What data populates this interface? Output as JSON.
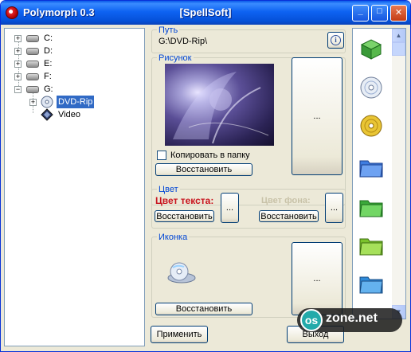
{
  "window": {
    "app_title": "Polymorph 0.3",
    "author": "[SpellSoft]",
    "minimize": "_",
    "maximize": "□",
    "close": "✕"
  },
  "tree": {
    "drives": [
      {
        "label": "C:",
        "expander": "+"
      },
      {
        "label": "D:",
        "expander": "+"
      },
      {
        "label": "E:",
        "expander": "+"
      },
      {
        "label": "F:",
        "expander": "+"
      },
      {
        "label": "G:",
        "expander": "−"
      }
    ],
    "children": [
      {
        "label": "DVD-Rip",
        "expander": "+",
        "selected": true
      },
      {
        "label": "Video"
      }
    ]
  },
  "path": {
    "legend": "Путь",
    "value": "G:\\DVD-Rip\\",
    "info_icon": "i"
  },
  "picture": {
    "legend": "Рисунок",
    "copy_label": "Копировать в папку",
    "restore": "Восстановить",
    "browse": "..."
  },
  "color": {
    "legend": "Цвет",
    "text_label": "Цвет текста:",
    "bg_label": "Цвет фона:",
    "restore_text": "Восстановить",
    "restore_bg": "Восстановить",
    "browse_text": "...",
    "browse_bg": "..."
  },
  "icon": {
    "legend": "Иконка",
    "restore": "Восстановить",
    "browse": "..."
  },
  "footer": {
    "apply": "Применить",
    "exit": "Выход"
  },
  "icon_strip": {
    "items": [
      "green-book-icon",
      "cd-disc-icon",
      "gold-cd-icon",
      "blue-folder-icon",
      "green-folder-icon",
      "lime-folder-icon",
      "blue-folder-icon"
    ],
    "up": "▲",
    "down": "▼"
  },
  "watermark": {
    "os": "os",
    "text": "zone.net"
  },
  "colors": {
    "titlebar": "#0e63f2",
    "selection": "#316ac5",
    "legend": "#0046d5",
    "text_color_label": "#c8141e"
  }
}
